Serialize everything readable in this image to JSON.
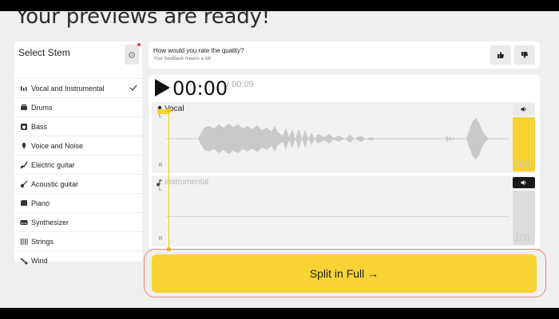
{
  "page": {
    "headline": "Your previews are ready!"
  },
  "stems": {
    "title": "Select Stem",
    "items": [
      {
        "label": "Vocal and Instrumental",
        "icon": "vocal-instrumental-icon",
        "selected": true
      },
      {
        "label": "Drums",
        "icon": "drums-icon"
      },
      {
        "label": "Bass",
        "icon": "bass-icon"
      },
      {
        "label": "Voice and Noise",
        "icon": "voice-noise-icon"
      },
      {
        "label": "Electric guitar",
        "icon": "electric-guitar-icon"
      },
      {
        "label": "Acoustic guitar",
        "icon": "acoustic-guitar-icon"
      },
      {
        "label": "Piano",
        "icon": "piano-icon"
      },
      {
        "label": "Synthesizer",
        "icon": "synthesizer-icon"
      },
      {
        "label": "Strings",
        "icon": "strings-icon"
      },
      {
        "label": "Wind",
        "icon": "wind-icon"
      }
    ]
  },
  "feedback": {
    "question": "How would you rate the quality?",
    "subtitle": "Your feedback means a lot!"
  },
  "player": {
    "current_time": "00:00",
    "total_time": "/ 00:09",
    "tracks": [
      {
        "name": "Vocal",
        "left_label": "L",
        "right_label": "R",
        "volume": "100",
        "volume_level": 1.0,
        "muted": false
      },
      {
        "name": "Instrumental",
        "left_label": "L",
        "right_label": "R",
        "volume": "100",
        "volume_level": 0.0,
        "muted": true
      }
    ]
  },
  "actions": {
    "split_label": "Split in Full →"
  },
  "colors": {
    "accent": "#f8d334",
    "outline": "#e8857a",
    "muted_button": "#1a1a1a"
  }
}
